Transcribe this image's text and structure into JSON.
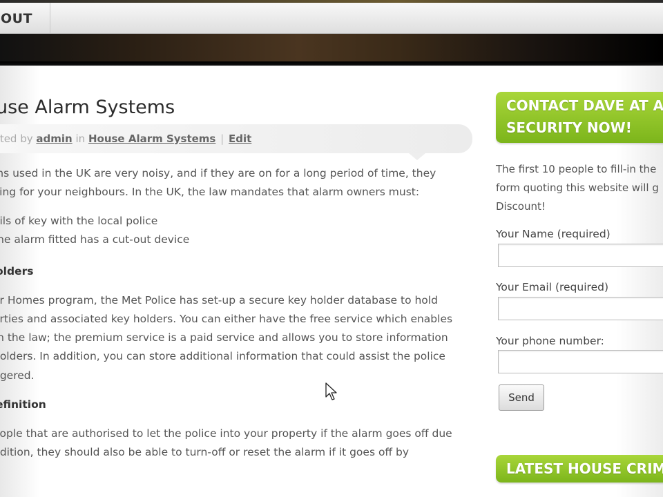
{
  "nav": {
    "about_label": "BOUT"
  },
  "post": {
    "title": "use Alarm Systems",
    "meta_posted": "sted by",
    "meta_author": "admin",
    "meta_in": "in",
    "meta_category": "House Alarm Systems",
    "meta_sep": "|",
    "meta_edit": "Edit",
    "intro_line1": "ms used in the UK are very noisy, and if they are on for a long period of time, they",
    "intro_line2": "ying for your neighbours. In the UK, the law mandates that alarm owners must:",
    "list_item1": "ails of key with the local police",
    "list_item2": "the alarm fitted has a cut-out device",
    "subhead1": "olders",
    "para2_line1": "er Homes program, the Met Police has set-up a secure key holder database to hold",
    "para2_line2": "erties and associated key holders. You can either have the free service which enables",
    "para2_line3": "th the law; the premium service is a paid service and allows you to store information",
    "para2_line4": "holders. In addition, you can store additional information that could assist the police",
    "para2_line5": "ggered.",
    "subhead2": "efinition",
    "para3_line1": "eople that are authorised to let the police into your property if the alarm goes off due",
    "para3_line2": "ddition, they should also be able to turn-off or reset the alarm if it goes off by"
  },
  "sidebar": {
    "contact_title_line1": "CONTACT DAVE AT A",
    "contact_title_line2": "SECURITY NOW!",
    "promo_line1": "The first 10 people to fill-in the",
    "promo_line2": "form quoting this website will g",
    "promo_line3": "Discount!",
    "name_label": "Your Name (required)",
    "email_label": "Your Email (required)",
    "phone_label": "Your phone number:",
    "send_label": "Send",
    "latest_title": "LATEST HOUSE CRIM"
  },
  "colors": {
    "accent_green": "#8cc423",
    "banner_dark": "#2a1f14"
  },
  "icons": {
    "cursor": "arrow-cursor-icon"
  }
}
